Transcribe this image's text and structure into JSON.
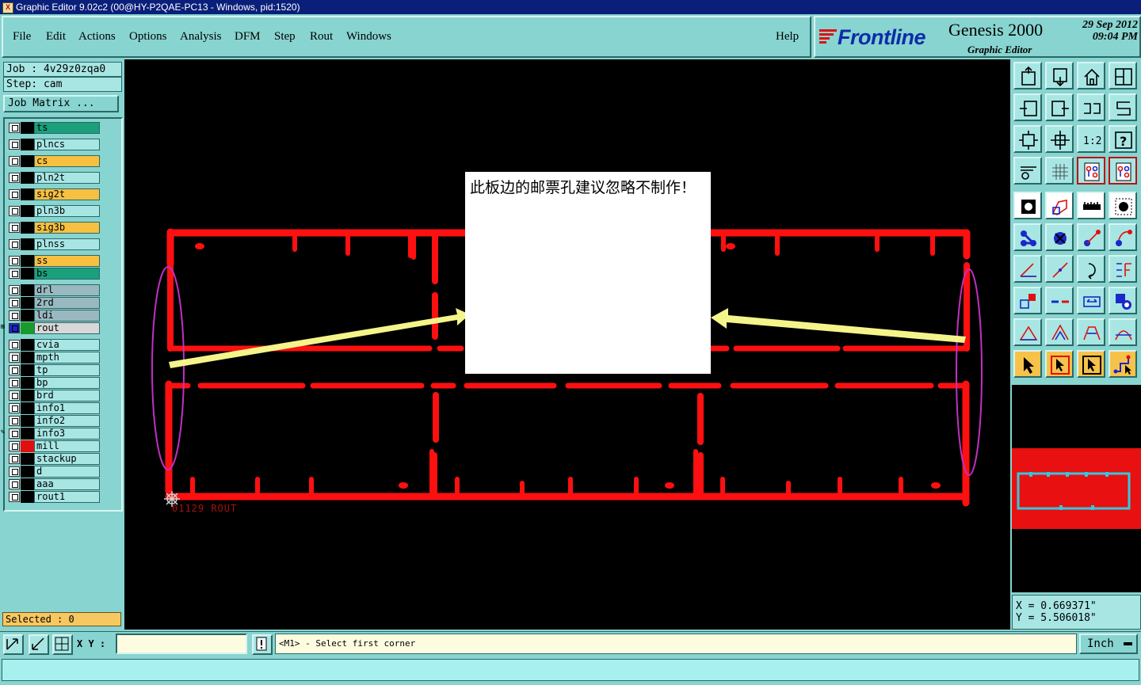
{
  "window": {
    "title": "Graphic Editor 9.02c2 (00@HY-P2QAE-PC13 - Windows, pid:1520)"
  },
  "menu": {
    "items": [
      {
        "id": "file",
        "label": "File"
      },
      {
        "id": "edit",
        "label": "Edit"
      },
      {
        "id": "actions",
        "label": "Actions"
      },
      {
        "id": "options",
        "label": "Options"
      },
      {
        "id": "analysis",
        "label": "Analysis"
      },
      {
        "id": "dfm",
        "label": "DFM"
      },
      {
        "id": "step",
        "label": "Step"
      },
      {
        "id": "rout",
        "label": "Rout"
      },
      {
        "id": "windows",
        "label": "Windows"
      }
    ],
    "help": "Help"
  },
  "banner": {
    "brand": "Frontline",
    "product": "Genesis 2000",
    "subtitle": "Graphic Editor",
    "date": "29 Sep 2012",
    "time": "09:04 PM"
  },
  "job": {
    "job_line": "Job : 4v29z0zqa0",
    "step_line": "Step: cam",
    "matrix_button": "Job Matrix ..."
  },
  "layers": [
    {
      "name": "ts",
      "bg": "#1aa07a",
      "swatch": "#000000"
    },
    {
      "name": "plncs",
      "bg": "#a8e6e4",
      "swatch": "#000000"
    },
    {
      "name": "cs",
      "bg": "#f8c040",
      "swatch": "#000000"
    },
    {
      "name": "pln2t",
      "bg": "#a8e6e4",
      "swatch": "#000000"
    },
    {
      "name": "sig2t",
      "bg": "#f8c040",
      "swatch": "#000000"
    },
    {
      "name": "pln3b",
      "bg": "#a8e6e4",
      "swatch": "#000000"
    },
    {
      "name": "sig3b",
      "bg": "#f8c040",
      "swatch": "#000000"
    },
    {
      "name": "plnss",
      "bg": "#a8e6e4",
      "swatch": "#000000"
    },
    {
      "name": "ss",
      "bg": "#f8c040",
      "swatch": "#000000"
    },
    {
      "name": "bs",
      "bg": "#1aa07a",
      "swatch": "#000000"
    },
    {
      "name": "drl",
      "bg": "#9ab8c0",
      "swatch": "#000000"
    },
    {
      "name": "2rd",
      "bg": "#9ab8c0",
      "swatch": "#000000"
    },
    {
      "name": "ldi",
      "bg": "#9ab8c0",
      "swatch": "#000000"
    },
    {
      "name": "rout",
      "bg": "#d8d8d8",
      "swatch": "#1a9a2a",
      "marker": "⊞",
      "active": true
    },
    {
      "name": "cvia",
      "bg": "#a8e6e4",
      "swatch": "#000000"
    },
    {
      "name": "mpth",
      "bg": "#a8e6e4",
      "swatch": "#000000"
    },
    {
      "name": "tp",
      "bg": "#a8e6e4",
      "swatch": "#000000"
    },
    {
      "name": "bp",
      "bg": "#a8e6e4",
      "swatch": "#000000"
    },
    {
      "name": "brd",
      "bg": "#a8e6e4",
      "swatch": "#000000"
    },
    {
      "name": "info1",
      "bg": "#a8e6e4",
      "swatch": "#000000"
    },
    {
      "name": "info2",
      "bg": "#a8e6e4",
      "swatch": "#000000"
    },
    {
      "name": "info3",
      "bg": "#a8e6e4",
      "swatch": "#000000",
      "marker": "✎"
    },
    {
      "name": "mill",
      "bg": "#a8e6e4",
      "swatch": "#e01010"
    },
    {
      "name": "stackup",
      "bg": "#a8e6e4",
      "swatch": "#000000"
    },
    {
      "name": "d",
      "bg": "#a8e6e4",
      "swatch": "#000000"
    },
    {
      "name": "aaa",
      "bg": "#a8e6e4",
      "swatch": "#000000"
    },
    {
      "name": "rout1",
      "bg": "#a8e6e4",
      "swatch": "#000000"
    }
  ],
  "selected": "Selected : 0",
  "canvas": {
    "note": "此板边的邮票孔建议忽略不制作！",
    "origin_label": "01129  ROUT",
    "colors": {
      "rout": "#ff1010",
      "arrow": "#f4f48a",
      "ellipse": "#c030c0"
    }
  },
  "toolbar": {
    "icons": [
      "zoom-home-icon",
      "zoom-down-icon",
      "home-icon",
      "window-split-icon",
      "pan-left-icon",
      "pan-right-icon",
      "swap-icon",
      "snake-icon",
      "fit-screen-icon",
      "fit-profile-icon",
      "zoom-ratio-icon",
      "help-question-icon",
      "measure-tool-icon",
      "grid-icon",
      "layers-display-icon",
      "layers-display-alt-icon",
      "fill-icon",
      "outline-icon",
      "ruler-icon",
      "dot-icon",
      "add-connection-icon",
      "cross-icon",
      "add-line-icon",
      "add-arc-icon",
      "angle-icon",
      "slash-icon",
      "rotate-icon",
      "mirror-icon",
      "move-object-icon",
      "break-line-icon",
      "dimension-icon",
      "snap-icon",
      "triangle-icon",
      "arc-triangle-icon",
      "arc-trapezoid-icon",
      "arc-line-icon",
      "select-pointer-icon",
      "select-box-icon",
      "select-in-icon",
      "select-net-icon"
    ],
    "zoom_ratio_label": "1:2",
    "help_label": "?"
  },
  "coords": {
    "x": "X = 0.669371\"",
    "y": "Y = 5.506018\""
  },
  "bottom": {
    "xy_label": "X Y :",
    "xy_value": "",
    "prompt": "<M1> - Select first corner",
    "unit": "Inch"
  }
}
